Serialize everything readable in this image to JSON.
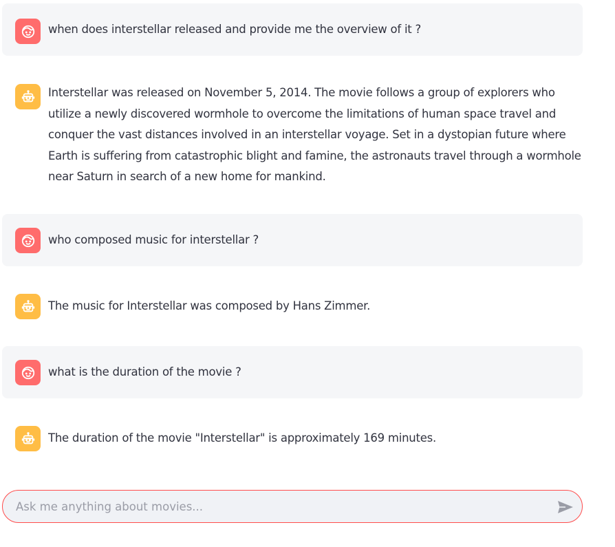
{
  "messages": [
    {
      "role": "user",
      "avatar_icon": "user-face-icon",
      "text": "when does interstellar released and provide me the overview of it ?"
    },
    {
      "role": "assistant",
      "avatar_icon": "robot-icon",
      "text": "Interstellar was released on November 5, 2014. The movie follows a group of explorers who utilize a newly discovered wormhole to overcome the limitations of human space travel and conquer the vast distances involved in an interstellar voyage. Set in a dystopian future where Earth is suffering from catastrophic blight and famine, the astronauts travel through a wormhole near Saturn in search of a new home for mankind."
    },
    {
      "role": "user",
      "avatar_icon": "user-face-icon",
      "text": "who composed music for interstellar ?"
    },
    {
      "role": "assistant",
      "avatar_icon": "robot-icon",
      "text": "The music for Interstellar was composed by Hans Zimmer."
    },
    {
      "role": "user",
      "avatar_icon": "user-face-icon",
      "text": "what is the duration of the movie ?"
    },
    {
      "role": "assistant",
      "avatar_icon": "robot-icon",
      "text": "The duration of the movie \"Interstellar\" is approximately 169 minutes."
    }
  ],
  "chat_input": {
    "placeholder": "Ask me anything about movies...",
    "value": "",
    "send_icon": "send-icon"
  },
  "colors": {
    "user_avatar": "#ff6c6c",
    "assistant_avatar": "#ffbd45",
    "user_bubble": "#f5f6f8",
    "input_border": "#ff4b4b",
    "input_background": "#f0f2f6",
    "text": "#31333f"
  }
}
